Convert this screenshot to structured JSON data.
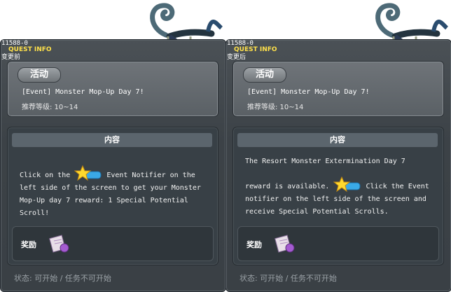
{
  "panels": [
    {
      "quest_id": "11588-0",
      "header_label": "QUEST INFO",
      "state_label": "变更前",
      "category": "活动",
      "title": "[Event] Monster Mop-Up Day 7!",
      "level": "推荐等级: 10~14",
      "content_header": "内容",
      "body": {
        "part1": "Click on the",
        "part2": " Event Notifier on the left side of the screen to get your Monster Mop-Up day 7 reward: 1 Special Potential Scroll!"
      },
      "reward_label": "奖励",
      "status": "状态: 可开始 / 任务不可开始"
    },
    {
      "quest_id": "11588-0",
      "header_label": "QUEST INFO",
      "state_label": "变更后",
      "category": "活动",
      "title": "[Event] Monster Mop-Up Day 7!",
      "level": "推荐等级: 10~14",
      "content_header": "内容",
      "body": {
        "line1": "The Resort Monster Extermination Day 7",
        "part1": "reward is available.",
        "part2": " Click the Event notifier on the left side of the screen and receive Special Potential Scrolls."
      },
      "reward_label": "奖励",
      "status": "状态: 可开始 / 任务不可开始"
    }
  ],
  "icons": {
    "notifier": "event-notifier-star-icon",
    "reward": "potential-scroll-icon",
    "decoration": "hanging-wooden-sign-icon"
  }
}
